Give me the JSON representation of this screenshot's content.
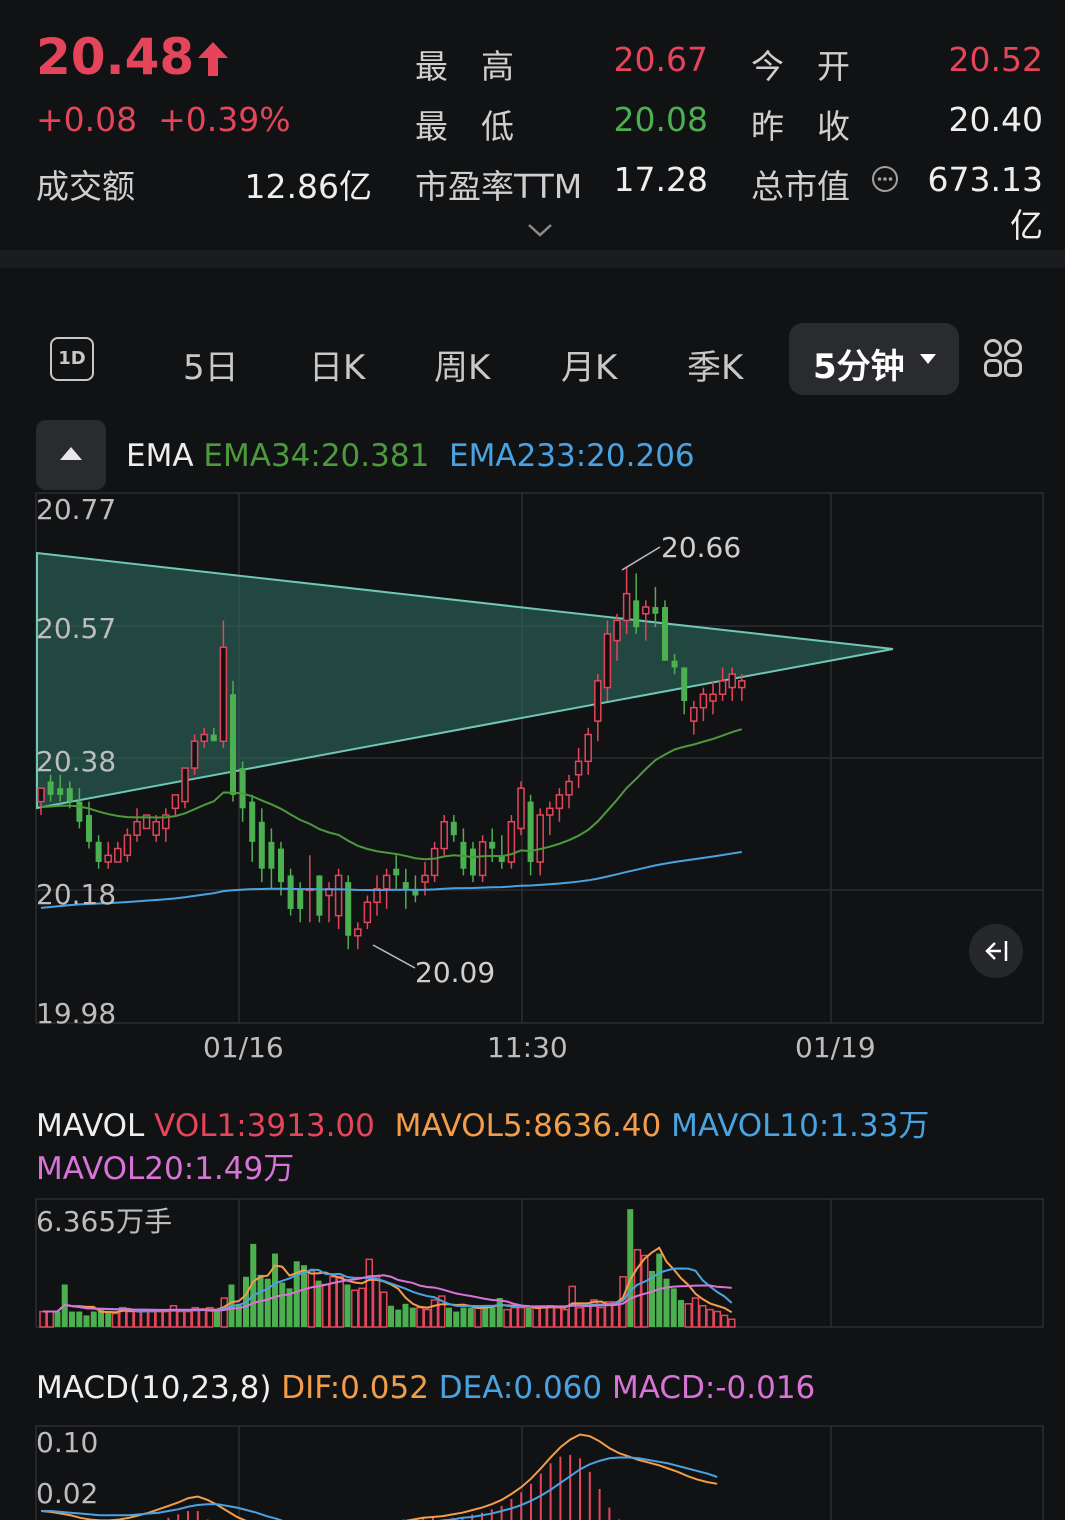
{
  "quote": {
    "price": "20.48",
    "change": "+0.08",
    "change_pct": "+0.39%",
    "turnover_label": "成交额",
    "turnover_value": "12.86亿",
    "high_label": "最　高",
    "high_value": "20.67",
    "low_label": "最　低",
    "low_value": "20.08",
    "pe_label": "市盈率TTM",
    "pe_value": "17.28",
    "open_label": "今　开",
    "open_value": "20.52",
    "prev_close_label": "昨　收",
    "prev_close_value": "20.40",
    "mcap_label": "总市值",
    "mcap_value": "673.13亿"
  },
  "tabs": {
    "items": [
      "5日",
      "日K",
      "周K",
      "月K",
      "季K"
    ],
    "active": "5分钟",
    "intraday_icon": "1D"
  },
  "indicators": {
    "ema_name": "EMA",
    "ema34": "EMA34:20.381",
    "ema233": "EMA233:20.206",
    "mavol_name": "MAVOL",
    "vol1": "VOL1:3913.00",
    "mavol5": "MAVOL5:8636.40",
    "mavol10": "MAVOL10:1.33万",
    "mavol20": "MAVOL20:1.49万",
    "macd_name": "MACD(10,23,8)",
    "dif": "DIF:0.052",
    "dea": "DEA:0.060",
    "macd": "MACD:-0.016"
  },
  "colors": {
    "up": "#e4455a",
    "down": "#4caf50",
    "ema34": "#4c9a3c",
    "ema233": "#4aa3e0",
    "mavol5": "#f39c4a",
    "mavol20": "#d873d8",
    "triangle": "#6fc7b5"
  },
  "chart_data": [
    {
      "type": "candlestick",
      "y_ticks": [
        "20.77",
        "20.57",
        "20.38",
        "20.18",
        "19.98"
      ],
      "x_ticks": [
        "01/16",
        "11:30",
        "01/19"
      ],
      "ylim": [
        19.98,
        20.77
      ],
      "annotations": {
        "high": "20.66",
        "low": "20.09"
      },
      "series": [
        {
          "name": "EMA34",
          "last": 20.381
        },
        {
          "name": "EMA233",
          "last": 20.206
        }
      ],
      "candles": [
        [
          20.31,
          20.33,
          20.29,
          20.33
        ],
        [
          20.34,
          20.35,
          20.31,
          20.32
        ],
        [
          20.33,
          20.35,
          20.31,
          20.32
        ],
        [
          20.33,
          20.34,
          20.3,
          20.31
        ],
        [
          20.31,
          20.33,
          20.27,
          20.28
        ],
        [
          20.29,
          20.31,
          20.24,
          20.25
        ],
        [
          20.25,
          20.26,
          20.21,
          20.22
        ],
        [
          20.22,
          20.25,
          20.21,
          20.23
        ],
        [
          20.22,
          20.25,
          20.22,
          20.24
        ],
        [
          20.23,
          20.27,
          20.22,
          20.26
        ],
        [
          20.26,
          20.3,
          20.25,
          20.28
        ],
        [
          20.27,
          20.29,
          20.27,
          20.29
        ],
        [
          20.26,
          20.29,
          20.25,
          20.28
        ],
        [
          20.27,
          20.3,
          20.25,
          20.29
        ],
        [
          20.3,
          20.32,
          20.29,
          20.32
        ],
        [
          20.31,
          20.36,
          20.3,
          20.36
        ],
        [
          20.36,
          20.41,
          20.35,
          20.4
        ],
        [
          20.4,
          20.42,
          20.39,
          20.41
        ],
        [
          20.41,
          20.42,
          20.4,
          20.4
        ],
        [
          20.4,
          20.58,
          20.39,
          20.54
        ],
        [
          20.47,
          20.49,
          20.31,
          20.32
        ],
        [
          20.36,
          20.37,
          20.28,
          20.3
        ],
        [
          20.31,
          20.32,
          20.22,
          20.25
        ],
        [
          20.28,
          20.3,
          20.19,
          20.21
        ],
        [
          20.25,
          20.27,
          20.18,
          20.21
        ],
        [
          20.24,
          20.25,
          20.17,
          20.19
        ],
        [
          20.2,
          20.21,
          20.14,
          20.15
        ],
        [
          20.18,
          20.19,
          20.13,
          20.15
        ],
        [
          20.18,
          20.23,
          20.13,
          20.18
        ],
        [
          20.2,
          20.2,
          20.13,
          20.14
        ],
        [
          20.17,
          20.19,
          20.13,
          20.18
        ],
        [
          20.14,
          20.21,
          20.12,
          20.2
        ],
        [
          20.19,
          20.2,
          20.09,
          20.11
        ],
        [
          20.11,
          20.13,
          20.09,
          20.12
        ],
        [
          20.13,
          20.17,
          20.12,
          20.16
        ],
        [
          20.16,
          20.2,
          20.14,
          20.18
        ],
        [
          20.18,
          20.21,
          20.15,
          20.2
        ],
        [
          20.21,
          20.23,
          20.18,
          20.2
        ],
        [
          20.19,
          20.21,
          20.15,
          20.18
        ],
        [
          20.18,
          20.2,
          20.16,
          20.17
        ],
        [
          20.19,
          20.22,
          20.17,
          20.2
        ],
        [
          20.2,
          20.25,
          20.19,
          20.24
        ],
        [
          20.24,
          20.29,
          20.23,
          20.28
        ],
        [
          20.28,
          20.29,
          20.25,
          20.26
        ],
        [
          20.25,
          20.27,
          20.2,
          20.21
        ],
        [
          20.24,
          20.25,
          20.19,
          20.2
        ],
        [
          20.2,
          20.26,
          20.19,
          20.25
        ],
        [
          20.25,
          20.27,
          20.22,
          20.24
        ],
        [
          20.23,
          20.26,
          20.21,
          20.22
        ],
        [
          20.22,
          20.29,
          20.21,
          20.28
        ],
        [
          20.27,
          20.34,
          20.26,
          20.33
        ],
        [
          20.31,
          20.32,
          20.2,
          20.22
        ],
        [
          20.22,
          20.3,
          20.2,
          20.29
        ],
        [
          20.29,
          20.31,
          20.26,
          20.3
        ],
        [
          20.3,
          20.33,
          20.28,
          20.32
        ],
        [
          20.32,
          20.35,
          20.3,
          20.34
        ],
        [
          20.35,
          20.39,
          20.33,
          20.37
        ],
        [
          20.37,
          20.42,
          20.35,
          20.41
        ],
        [
          20.43,
          20.5,
          20.4,
          20.49
        ],
        [
          20.48,
          20.58,
          20.46,
          20.56
        ],
        [
          20.55,
          20.59,
          20.52,
          20.58
        ],
        [
          20.58,
          20.66,
          20.56,
          20.62
        ],
        [
          20.61,
          20.65,
          20.56,
          20.57
        ],
        [
          20.59,
          20.61,
          20.55,
          20.6
        ],
        [
          20.6,
          20.63,
          20.57,
          20.59
        ],
        [
          20.6,
          20.61,
          20.52,
          20.52
        ],
        [
          20.52,
          20.53,
          20.5,
          20.51
        ],
        [
          20.51,
          20.51,
          20.44,
          20.46
        ],
        [
          20.43,
          20.46,
          20.41,
          20.45
        ],
        [
          20.45,
          20.48,
          20.43,
          20.47
        ],
        [
          20.46,
          20.49,
          20.44,
          20.47
        ],
        [
          20.47,
          20.51,
          20.46,
          20.49
        ],
        [
          20.48,
          20.51,
          20.46,
          20.5
        ],
        [
          20.48,
          20.5,
          20.46,
          20.49
        ]
      ]
    },
    {
      "type": "bar",
      "y_ticks": [
        "6.365万手"
      ],
      "series_names": [
        "VOL",
        "MAVOL5",
        "MAVOL10",
        "MAVOL20"
      ],
      "values": [
        0.8,
        0.8,
        0.8,
        2.2,
        0.8,
        0.8,
        0.6,
        0.8,
        0.9,
        0.8,
        0.7,
        1.0,
        0.8,
        0.8,
        0.9,
        0.8,
        0.8,
        0.8,
        1.1,
        0.8,
        0.8,
        1.0,
        0.9,
        1.0,
        0.8,
        1.5,
        2.2,
        1.2,
        2.6,
        4.3,
        2.7,
        2.5,
        3.8,
        2.3,
        2.0,
        3.4,
        3.2,
        2.9,
        2.4,
        2.2,
        2.6,
        2.6,
        2.2,
        1.9,
        2.0,
        3.5,
        2.6,
        1.8,
        1.1,
        0.9,
        1.2,
        1.0,
        1.0,
        0.9,
        1.4,
        1.6,
        1.0,
        0.8,
        1.0,
        1.0,
        1.1,
        1.1,
        1.0,
        1.5,
        0.9,
        1.0,
        1.0,
        1.0,
        1.0,
        1.0,
        1.1,
        1.0,
        0.9,
        2.1,
        1.0,
        1.1,
        1.4,
        1.0,
        1.3,
        1.3,
        2.6,
        6.1,
        4.0,
        3.7,
        2.9,
        3.8,
        2.5,
        2.0,
        1.4,
        1.2,
        1.5,
        1.1,
        0.9,
        0.8,
        0.6,
        0.4
      ]
    },
    {
      "type": "bar",
      "y_ticks": [
        "0.10",
        "0.02"
      ],
      "ylim": [
        -0.02,
        0.12
      ],
      "series_names": [
        "DIF",
        "DEA",
        "MACD"
      ],
      "dif": [
        0.02,
        0.019,
        0.017,
        0.015,
        0.012,
        0.01,
        0.009,
        0.009,
        0.01,
        0.012,
        0.015,
        0.018,
        0.022,
        0.026,
        0.03,
        0.035,
        0.037,
        0.033,
        0.027,
        0.02,
        0.013,
        0.008,
        0.004,
        0.0,
        -0.003,
        -0.005,
        -0.007,
        -0.008,
        -0.008,
        -0.007,
        -0.006,
        -0.004,
        -0.002,
        0.0,
        0.002,
        0.004,
        0.006,
        0.008,
        0.01,
        0.012,
        0.013,
        0.014,
        0.016,
        0.018,
        0.021,
        0.024,
        0.028,
        0.033,
        0.04,
        0.048,
        0.058,
        0.07,
        0.083,
        0.095,
        0.104,
        0.11,
        0.108,
        0.102,
        0.094,
        0.088,
        0.084,
        0.08,
        0.077,
        0.074,
        0.07,
        0.066,
        0.061,
        0.057,
        0.054,
        0.052
      ],
      "dea": [
        0.02,
        0.02,
        0.019,
        0.018,
        0.017,
        0.016,
        0.015,
        0.015,
        0.015,
        0.015,
        0.016,
        0.017,
        0.018,
        0.02,
        0.022,
        0.025,
        0.027,
        0.028,
        0.028,
        0.026,
        0.024,
        0.021,
        0.018,
        0.014,
        0.011,
        0.007,
        0.004,
        0.002,
        0.0,
        -0.001,
        -0.002,
        -0.002,
        -0.002,
        -0.001,
        0.0,
        0.001,
        0.002,
        0.003,
        0.005,
        0.006,
        0.007,
        0.009,
        0.01,
        0.012,
        0.013,
        0.015,
        0.017,
        0.02,
        0.023,
        0.027,
        0.032,
        0.038,
        0.045,
        0.053,
        0.061,
        0.069,
        0.075,
        0.079,
        0.082,
        0.083,
        0.083,
        0.082,
        0.08,
        0.078,
        0.076,
        0.073,
        0.07,
        0.067,
        0.064,
        0.06
      ]
    }
  ]
}
